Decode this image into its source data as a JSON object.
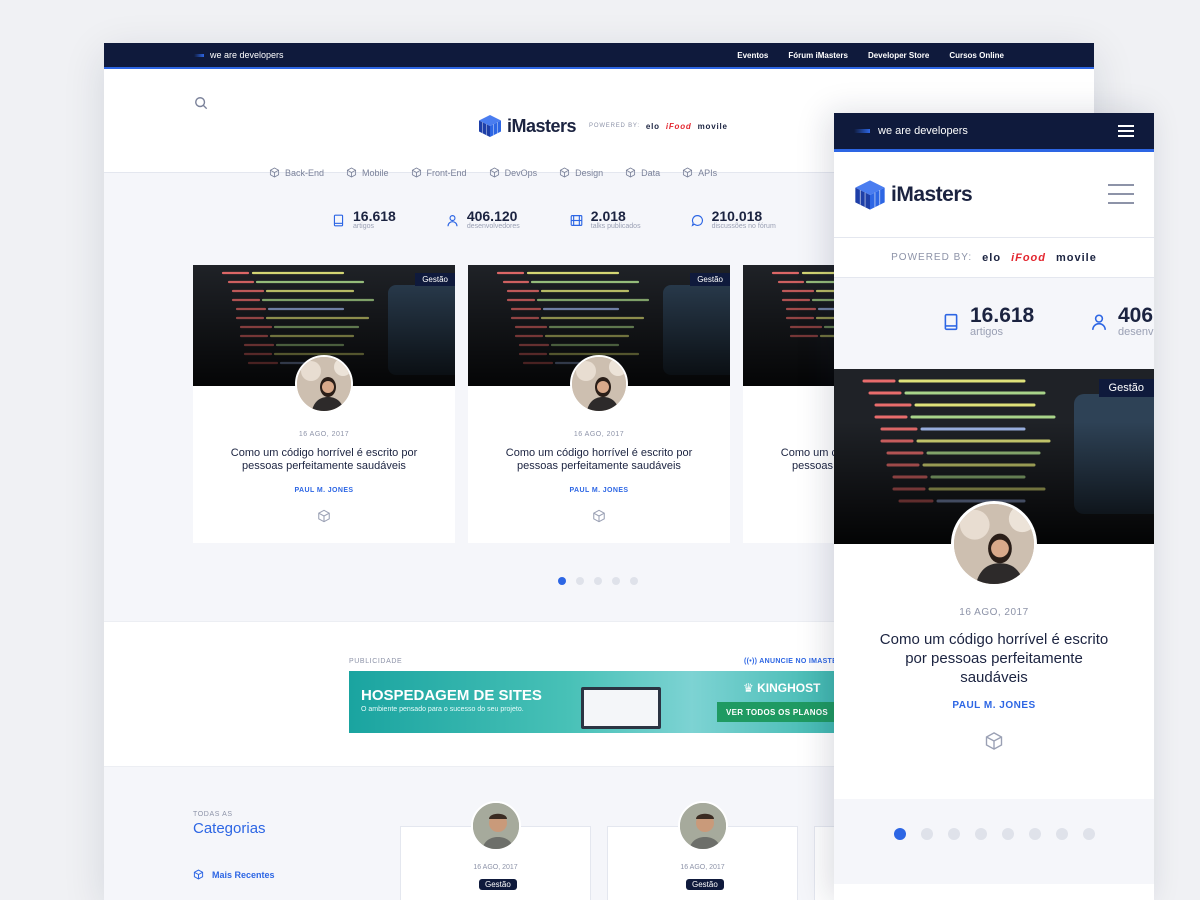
{
  "brand": {
    "tagline": "we are developers",
    "name": "iMasters",
    "powered_by": "POWERED BY:",
    "sponsors": [
      "elo",
      "iFood",
      "movile"
    ],
    "accent_color": "#2d66e4",
    "dark_color": "#0f1a3c"
  },
  "topnav": [
    "Eventos",
    "Fórum iMasters",
    "Developer Store",
    "Cursos Online"
  ],
  "social_icons": [
    "facebook-icon",
    "twitter-icon",
    "youtube-icon",
    "linkedin-icon"
  ],
  "categories_nav": [
    "Back-End",
    "Mobile",
    "Front-End",
    "DevOps",
    "Design",
    "Data",
    "APIs"
  ],
  "stats": [
    {
      "value": "16.618",
      "label": "artigos",
      "icon": "book-icon"
    },
    {
      "value": "406.120",
      "label": "desenvolvedores",
      "icon": "user-icon"
    },
    {
      "value": "2.018",
      "label": "talks publicados",
      "icon": "film-icon"
    },
    {
      "value": "210.018",
      "label": "discussões no fórum",
      "icon": "chat-icon"
    }
  ],
  "article": {
    "tag": "Gestão",
    "date": "16 AGO, 2017",
    "title": "Como um código horrível é escrito por pessoas perfeitamente saudáveis",
    "author": "PAUL M. JONES"
  },
  "carousel": {
    "desktop_dots": 5,
    "mobile_dots": 8,
    "active": 0
  },
  "ad": {
    "label": "PUBLICIDADE",
    "link": "ANUNCIE NO IMASTERS",
    "headline": "HOSPEDAGEM DE SITES",
    "subline": "O ambiente pensado para o sucesso do seu projeto.",
    "advertiser": "KINGHOST",
    "cta": "VER TODOS OS PLANOS"
  },
  "categories_section": {
    "small": "TODAS AS",
    "title": "Categorias",
    "first_item": "Mais Recentes",
    "mini_date": "16 AGO, 2017",
    "mini_tag": "Gestão"
  },
  "mobile_stats_visible": [
    {
      "value": "16.618",
      "label": "artigos"
    },
    {
      "value": "406",
      "label": "desenv"
    }
  ]
}
